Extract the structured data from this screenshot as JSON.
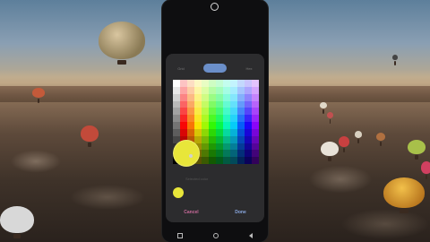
{
  "dialog": {
    "tabs": [
      {
        "label": "Grid",
        "active": false
      },
      {
        "label": "Spectrum",
        "active": true
      },
      {
        "label": "Hex",
        "active": false
      }
    ],
    "preview_label": "Selected color",
    "selected_color": "#e8e63a",
    "cancel_label": "Cancel",
    "done_label": "Done"
  },
  "colors": {
    "phone_bg": "#0e0e10",
    "dialog_bg": "#2c2c2e",
    "accent": "#6b8fc9",
    "cancel": "#c86a9a",
    "done": "#8aa8e0"
  },
  "icons": [
    "camera-icon",
    "recent-apps-icon",
    "home-icon",
    "back-icon"
  ]
}
